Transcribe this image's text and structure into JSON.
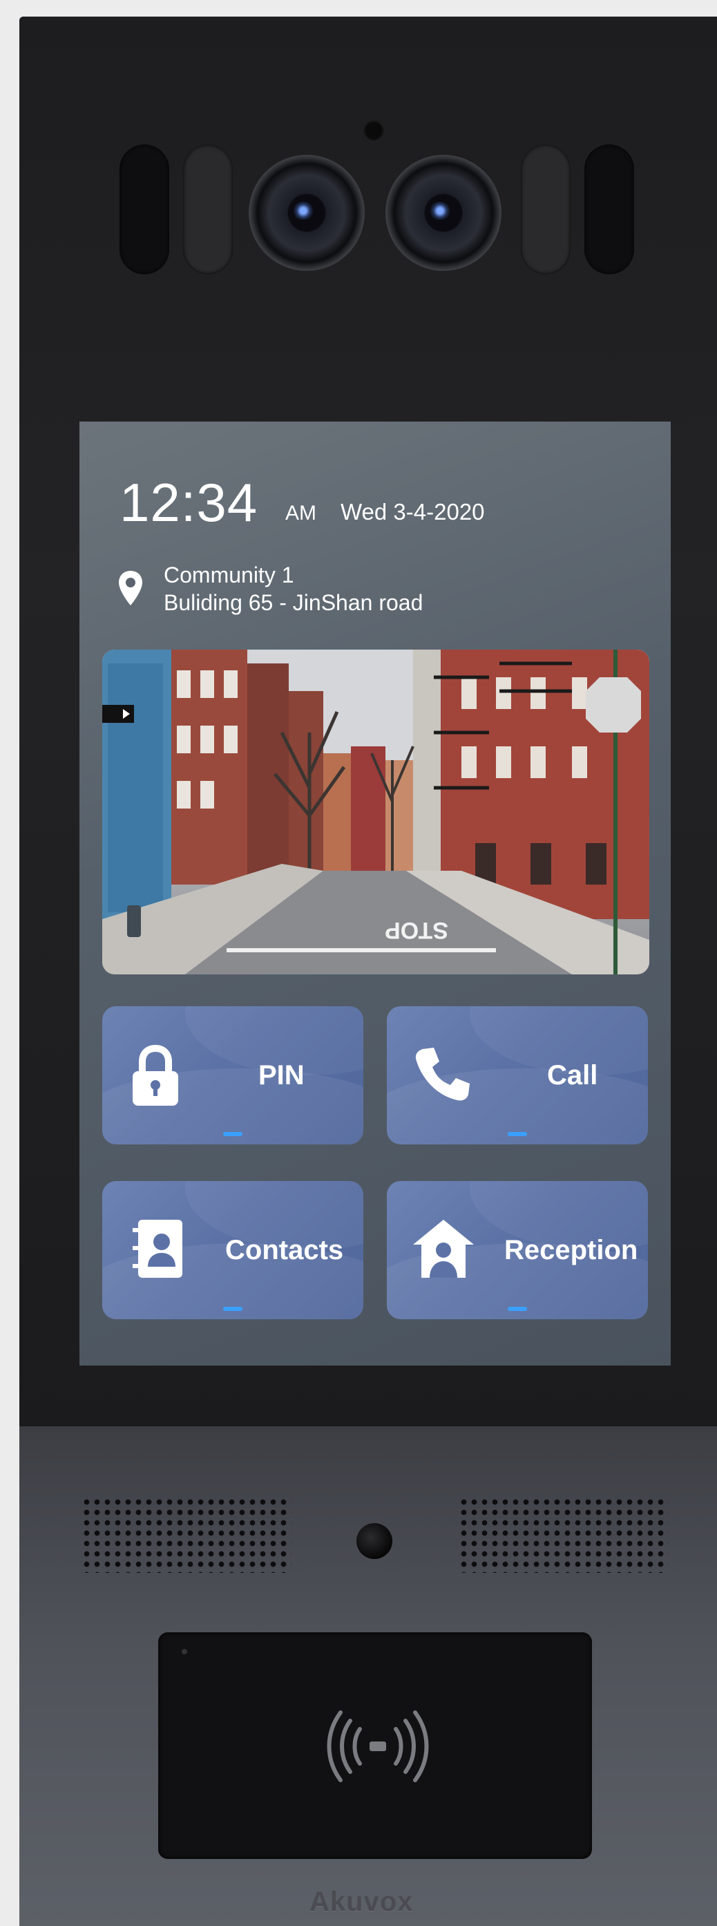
{
  "screen": {
    "time": "12:34",
    "ampm": "AM",
    "date": "Wed 3-4-2020",
    "location": {
      "line1": "Community 1",
      "line2": "Buliding 65 - JinShan road"
    },
    "camera_view": {
      "street_marking": "STOP"
    },
    "buttons": [
      {
        "id": "pin",
        "label": "PIN",
        "icon": "lock-icon"
      },
      {
        "id": "call",
        "label": "Call",
        "icon": "phone-icon"
      },
      {
        "id": "contacts",
        "label": "Contacts",
        "icon": "contacts-book-icon"
      },
      {
        "id": "reception",
        "label": "Reception",
        "icon": "house-person-icon"
      }
    ],
    "indicator_color": "#3aa0ff"
  },
  "device": {
    "brand": "Akuvox",
    "card_reader_icon": "nfc-icon"
  }
}
